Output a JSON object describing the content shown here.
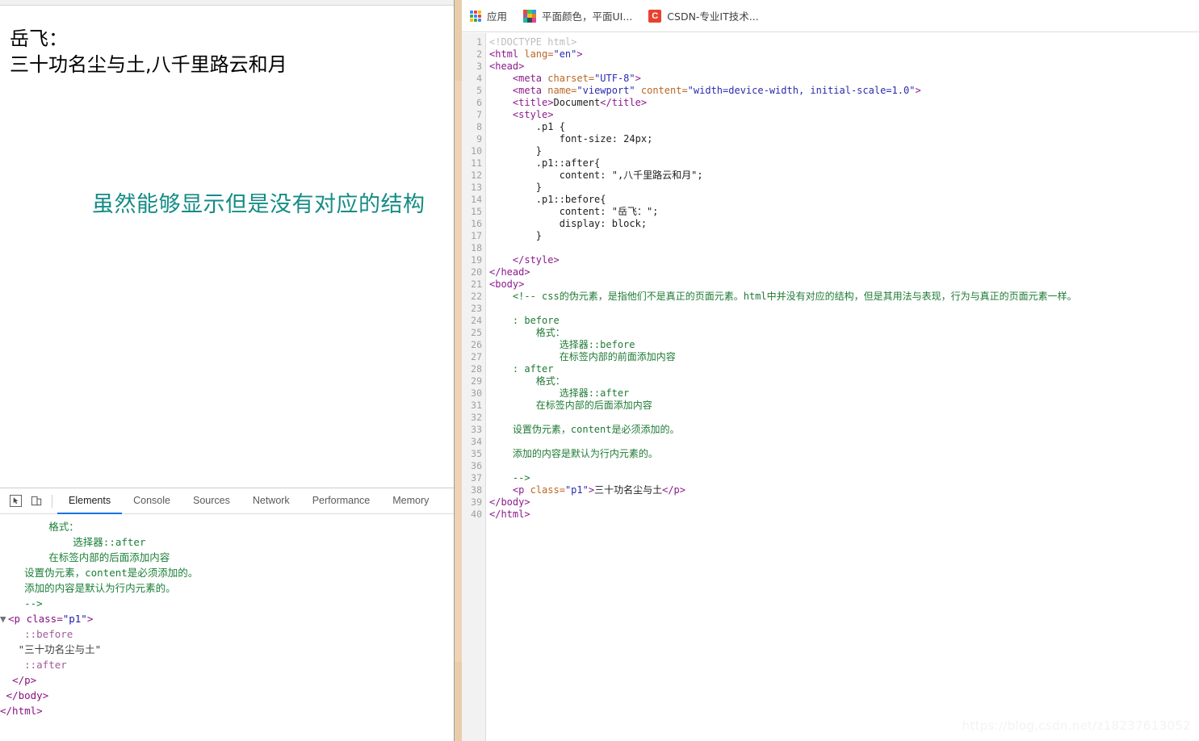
{
  "browser": {
    "rendered_page": {
      "before_text": "岳飞：",
      "main_text": "三十功名尘与土",
      "after_text": ",八千里路云和月"
    },
    "annotation": "虽然能够显示但是没有对应的结构"
  },
  "devtools": {
    "inspect_icon": "inspect-cursor-icon",
    "device_icon": "device-toolbar-icon",
    "tabs": [
      {
        "label": "Elements",
        "active": true
      },
      {
        "label": "Console",
        "active": false
      },
      {
        "label": "Sources",
        "active": false
      },
      {
        "label": "Network",
        "active": false
      },
      {
        "label": "Performance",
        "active": false
      },
      {
        "label": "Memory",
        "active": false
      }
    ],
    "dom_lines": [
      "        格式：",
      "            选择器::after",
      "        在标签内部的后面添加内容",
      "",
      "    设置伪元素，content是必须添加的。",
      "",
      "    添加的内容是默认为行内元素的。",
      "",
      "    -->"
    ],
    "dom_tree": {
      "open_tag_prefix": "<p class=",
      "open_tag_class": "\"p1\"",
      "open_tag_suffix": ">",
      "pseudo_before": "::before",
      "text_node": "\"三十功名尘与土\"",
      "pseudo_after": "::after",
      "close_p": "</p>",
      "close_body": "</body>",
      "close_html": "</html>"
    }
  },
  "bookmark_bar": {
    "apps_label": "应用",
    "items": [
      {
        "label": "平面颜色，平面UI...",
        "icon": "color-grid-favicon"
      },
      {
        "label": "CSDN-专业IT技术...",
        "icon": "csdn-favicon",
        "icon_letter": "C"
      }
    ]
  },
  "editor": {
    "line_numbers": [
      1,
      2,
      3,
      4,
      5,
      6,
      7,
      8,
      9,
      10,
      11,
      12,
      13,
      14,
      15,
      16,
      17,
      18,
      19,
      20,
      21,
      22,
      23,
      24,
      25,
      26,
      27,
      28,
      29,
      30,
      31,
      32,
      33,
      34,
      35,
      36,
      37,
      38,
      39,
      40
    ],
    "code": [
      {
        "n": 1,
        "tokens": [
          {
            "t": "doctype",
            "s": "<!DOCTYPE html>"
          }
        ]
      },
      {
        "n": 2,
        "tokens": [
          {
            "t": "tag",
            "s": "<html "
          },
          {
            "t": "attr",
            "s": "lang="
          },
          {
            "t": "str",
            "s": "\"en\""
          },
          {
            "t": "tag",
            "s": ">"
          }
        ]
      },
      {
        "n": 3,
        "tokens": [
          {
            "t": "tag",
            "s": "<head>"
          }
        ]
      },
      {
        "n": 4,
        "tokens": [
          {
            "t": "plain",
            "s": "    "
          },
          {
            "t": "tag",
            "s": "<meta "
          },
          {
            "t": "attr",
            "s": "charset="
          },
          {
            "t": "str",
            "s": "\"UTF-8\""
          },
          {
            "t": "tag",
            "s": ">"
          }
        ]
      },
      {
        "n": 5,
        "tokens": [
          {
            "t": "plain",
            "s": "    "
          },
          {
            "t": "tag",
            "s": "<meta "
          },
          {
            "t": "attr",
            "s": "name="
          },
          {
            "t": "str",
            "s": "\"viewport\""
          },
          {
            "t": "plain",
            "s": " "
          },
          {
            "t": "attr",
            "s": "content="
          },
          {
            "t": "str",
            "s": "\"width=device-width, initial-scale=1.0\""
          },
          {
            "t": "tag",
            "s": ">"
          }
        ]
      },
      {
        "n": 6,
        "tokens": [
          {
            "t": "plain",
            "s": "    "
          },
          {
            "t": "tag",
            "s": "<title>"
          },
          {
            "t": "plain",
            "s": "Document"
          },
          {
            "t": "tag",
            "s": "</title>"
          }
        ]
      },
      {
        "n": 7,
        "tokens": [
          {
            "t": "plain",
            "s": "    "
          },
          {
            "t": "tag",
            "s": "<style>"
          }
        ]
      },
      {
        "n": 8,
        "tokens": [
          {
            "t": "plain",
            "s": "        .p1 {"
          }
        ]
      },
      {
        "n": 9,
        "tokens": [
          {
            "t": "plain",
            "s": "            font-size: 24px;"
          }
        ]
      },
      {
        "n": 10,
        "tokens": [
          {
            "t": "plain",
            "s": "        }"
          }
        ]
      },
      {
        "n": 11,
        "tokens": [
          {
            "t": "plain",
            "s": "        .p1::after{"
          }
        ]
      },
      {
        "n": 12,
        "tokens": [
          {
            "t": "plain",
            "s": "            content: \",八千里路云和月\";"
          }
        ]
      },
      {
        "n": 13,
        "tokens": [
          {
            "t": "plain",
            "s": "        }"
          }
        ]
      },
      {
        "n": 14,
        "tokens": [
          {
            "t": "plain",
            "s": "        .p1::before{"
          }
        ]
      },
      {
        "n": 15,
        "tokens": [
          {
            "t": "plain",
            "s": "            content: \"岳飞：\";"
          }
        ]
      },
      {
        "n": 16,
        "tokens": [
          {
            "t": "plain",
            "s": "            display: block;"
          }
        ]
      },
      {
        "n": 17,
        "tokens": [
          {
            "t": "plain",
            "s": "        }"
          }
        ]
      },
      {
        "n": 18,
        "tokens": [
          {
            "t": "plain",
            "s": ""
          }
        ]
      },
      {
        "n": 19,
        "tokens": [
          {
            "t": "plain",
            "s": "    "
          },
          {
            "t": "tag",
            "s": "</style>"
          }
        ]
      },
      {
        "n": 20,
        "tokens": [
          {
            "t": "tag",
            "s": "</head>"
          }
        ]
      },
      {
        "n": 21,
        "tokens": [
          {
            "t": "tag",
            "s": "<body>"
          }
        ]
      },
      {
        "n": 22,
        "tokens": [
          {
            "t": "plain",
            "s": "    "
          },
          {
            "t": "cmt",
            "s": "<!-- css的伪元素，是指他们不是真正的页面元素。html中并没有对应的结构，但是其用法与表现，行为与真正的页面元素一样。"
          }
        ]
      },
      {
        "n": 23,
        "tokens": [
          {
            "t": "cmt",
            "s": ""
          }
        ]
      },
      {
        "n": 24,
        "tokens": [
          {
            "t": "cmt",
            "s": "    : before"
          }
        ]
      },
      {
        "n": 25,
        "tokens": [
          {
            "t": "cmt",
            "s": "        格式："
          }
        ]
      },
      {
        "n": 26,
        "tokens": [
          {
            "t": "cmt",
            "s": "            选择器::before"
          }
        ]
      },
      {
        "n": 27,
        "tokens": [
          {
            "t": "cmt",
            "s": "            在标签内部的前面添加内容"
          }
        ]
      },
      {
        "n": 28,
        "tokens": [
          {
            "t": "cmt",
            "s": "    : after"
          }
        ]
      },
      {
        "n": 29,
        "tokens": [
          {
            "t": "cmt",
            "s": "        格式："
          }
        ]
      },
      {
        "n": 30,
        "tokens": [
          {
            "t": "cmt",
            "s": "            选择器::after"
          }
        ]
      },
      {
        "n": 31,
        "tokens": [
          {
            "t": "cmt",
            "s": "        在标签内部的后面添加内容"
          }
        ]
      },
      {
        "n": 32,
        "tokens": [
          {
            "t": "cmt",
            "s": ""
          }
        ]
      },
      {
        "n": 33,
        "tokens": [
          {
            "t": "cmt",
            "s": "    设置伪元素，content是必须添加的。"
          }
        ]
      },
      {
        "n": 34,
        "tokens": [
          {
            "t": "cmt",
            "s": ""
          }
        ]
      },
      {
        "n": 35,
        "tokens": [
          {
            "t": "cmt",
            "s": "    添加的内容是默认为行内元素的。"
          }
        ]
      },
      {
        "n": 36,
        "tokens": [
          {
            "t": "cmt",
            "s": ""
          }
        ]
      },
      {
        "n": 37,
        "tokens": [
          {
            "t": "cmt",
            "s": "    -->"
          }
        ]
      },
      {
        "n": 38,
        "tokens": [
          {
            "t": "plain",
            "s": "    "
          },
          {
            "t": "tag",
            "s": "<p "
          },
          {
            "t": "attr",
            "s": "class="
          },
          {
            "t": "str",
            "s": "\"p1\""
          },
          {
            "t": "tag",
            "s": ">"
          },
          {
            "t": "plain",
            "s": "三十功名尘与土"
          },
          {
            "t": "tag",
            "s": "</p>"
          }
        ]
      },
      {
        "n": 39,
        "tokens": [
          {
            "t": "tag",
            "s": "</body>"
          }
        ]
      },
      {
        "n": 40,
        "tokens": [
          {
            "t": "tag",
            "s": "</html>"
          }
        ]
      }
    ]
  },
  "watermark": "https://blog.csdn.net/z18237613052",
  "colors": {
    "accent_tab": "#1a73e8",
    "annotation": "#158c86",
    "comment_green": "#1f7a34",
    "tag_purple": "#8b1a8b",
    "attr_orange": "#bb6622",
    "string_blue": "#2a2ab0",
    "splitter_beige": "#e9cdaa",
    "csdn_red": "#e8422f"
  }
}
